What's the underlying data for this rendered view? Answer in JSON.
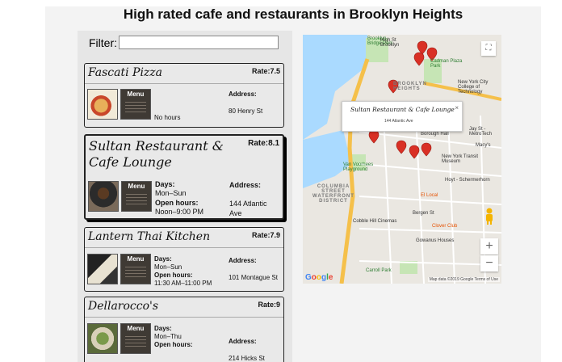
{
  "page": {
    "title": "High rated cafe and restaurants in Brooklyn Heights"
  },
  "filter": {
    "label": "Filter:",
    "value": ""
  },
  "restaurants": [
    {
      "name": "Fascati Pizza",
      "rate": "Rate:7.5",
      "hours_note": "No hours",
      "address_label": "Address:",
      "address": "80 Henry St"
    },
    {
      "name": "Sultan Restaurant & Cafe Lounge",
      "rate": "Rate:8.1",
      "days_label": "Days:",
      "days": "Mon–Sun",
      "open_label": "Open hours:",
      "open": "Noon–9:00 PM",
      "address_label": "Address:",
      "address": "144 Atlantic Ave"
    },
    {
      "name": "Lantern Thai Kitchen",
      "rate": "Rate:7.9",
      "days_label": "Days:",
      "days": "Mon–Sun",
      "open_label": "Open hours:",
      "open": "11:30 AM–11:00 PM",
      "address_label": "Address:",
      "address": "101 Montague St"
    },
    {
      "name": "Dellarocco's",
      "rate": "Rate:9",
      "days_label": "Days:",
      "days": "Mon–Thu",
      "open_label": "Open hours:",
      "open": "",
      "address_label": "Address:",
      "address": "214 Hicks St"
    }
  ],
  "menu_thumb_label": "Menu",
  "map": {
    "infowindow_title": "Sultan Restaurant & Cafe Lounge",
    "infowindow_address": "144 Atlantic Ave",
    "close_glyph": "×",
    "zoom_in": "+",
    "zoom_out": "−",
    "fullscreen_glyph": "⛶",
    "attribution": "Map data ©2019 Google   Terms of Use",
    "logo": "Google",
    "labels": {
      "brooklyn_bridge_park": "Brooklyn Bridge Park",
      "brooklyn_heights": "BROOKLYN HEIGHTS",
      "columbia_street": "COLUMBIA STREET WATERFRONT DISTRICT",
      "cadman_plaza": "Cadman Plaza Park",
      "ny_city_college": "New York City College of Technology",
      "borough_hall": "Borough Hall",
      "van_voorhees": "Van Voorhees Playground",
      "cobble_hill_cinemas": "Cobble Hill Cinemas",
      "bergen_st": "Bergen St",
      "clover_club": "Clover Club",
      "gowanus_houses": "Gowanus Houses",
      "carroll_park": "Carroll Park",
      "hoyt_schermerhorn": "Hoyt - Schermerhorn",
      "jay_st": "Jay St - MetroTech",
      "macys": "Macy's",
      "ny_transit_museum": "New York Transit Museum",
      "high_st": "High St Brooklyn",
      "el_local": "El Local"
    },
    "pin_color": "#d93025"
  }
}
